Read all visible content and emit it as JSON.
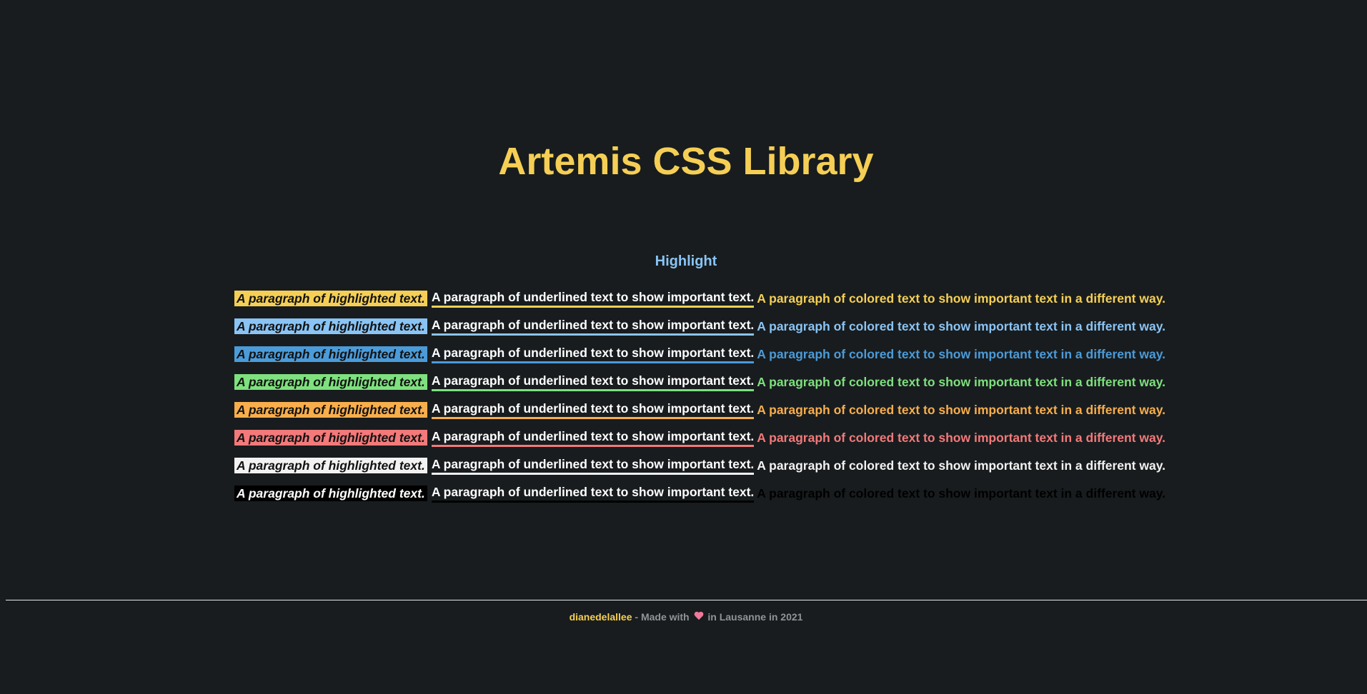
{
  "page": {
    "title": "Artemis CSS Library",
    "section_title": "Highlight"
  },
  "colors": {
    "yellow": "#f5cf55",
    "light_blue": "#8ac4f5",
    "blue": "#4b9bd9",
    "green": "#7ee07e",
    "orange": "#f8ae4c",
    "red": "#f3797a",
    "white": "#f2f2f2",
    "black": "#000000"
  },
  "rows": [
    {
      "color": "#f5cf55",
      "highlight_text": "A paragraph of highlighted text.",
      "underline_text": "A paragraph of underlined text to show important text.",
      "colored_text": "A paragraph of colored text to show important text in a different way."
    },
    {
      "color": "#8ac4f5",
      "highlight_text": "A paragraph of highlighted text.",
      "underline_text": "A paragraph of underlined text to show important text.",
      "colored_text": "A paragraph of colored text to show important text in a different way."
    },
    {
      "color": "#4b9bd9",
      "highlight_text": "A paragraph of highlighted text.",
      "underline_text": "A paragraph of underlined text to show important text.",
      "colored_text": "A paragraph of colored text to show important text in a different way."
    },
    {
      "color": "#7ee07e",
      "highlight_text": "A paragraph of highlighted text.",
      "underline_text": "A paragraph of underlined text to show important text.",
      "colored_text": "A paragraph of colored text to show important text in a different way."
    },
    {
      "color": "#f8ae4c",
      "highlight_text": "A paragraph of highlighted text.",
      "underline_text": "A paragraph of underlined text to show important text.",
      "colored_text": "A paragraph of colored text to show important text in a different way."
    },
    {
      "color": "#f3797a",
      "highlight_text": "A paragraph of highlighted text.",
      "underline_text": "A paragraph of underlined text to show important text.",
      "colored_text": "A paragraph of colored text to show important text in a different way."
    },
    {
      "color": "#f2f2f2",
      "highlight_text": "A paragraph of highlighted text.",
      "underline_text": "A paragraph of underlined text to show important text.",
      "colored_text": "A paragraph of colored text to show important text in a different way."
    },
    {
      "color": "#000000",
      "highlight_text": "A paragraph of highlighted text.",
      "underline_text": "A paragraph of underlined text to show important text.",
      "colored_text": "A paragraph of colored text to show important text in a different way."
    }
  ],
  "footer": {
    "author": "dianedelallee",
    "text_before_icon": " - Made with ",
    "icon": "heart-icon",
    "text_after_icon": " in Lausanne in 2021"
  }
}
